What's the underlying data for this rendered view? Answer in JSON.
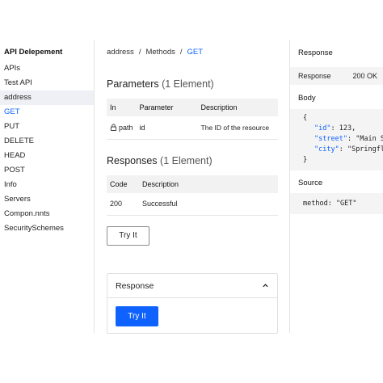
{
  "sidebar": {
    "title": "API Delepement",
    "items": [
      {
        "label": "APIs"
      },
      {
        "label": "Test API"
      },
      {
        "label": "address"
      },
      {
        "label": "GET"
      },
      {
        "label": "PUT"
      },
      {
        "label": "DELETE"
      },
      {
        "label": "HEAD"
      },
      {
        "label": "POST"
      },
      {
        "label": "Info"
      },
      {
        "label": "Servers"
      },
      {
        "label": "Compon.nnts"
      },
      {
        "label": "SecuritySchemes"
      }
    ]
  },
  "breadcrumb": {
    "items": [
      "address",
      "Methods",
      "GET"
    ],
    "separator": "/"
  },
  "parameters": {
    "title": "Parameters",
    "count": "(1 Element)",
    "headers": [
      "In",
      "Parameter",
      "Description"
    ],
    "rows": [
      {
        "in": "path",
        "parameter": "id",
        "description": "The ID of the resource"
      }
    ]
  },
  "responses": {
    "title": "Responses",
    "count": "(1 Element)",
    "headers": [
      "Code",
      "Description"
    ],
    "rows": [
      {
        "code": "200",
        "description": "Successful"
      }
    ]
  },
  "try_it_label": "Try It",
  "response_panel": {
    "title": "Response",
    "try_label": "Try It"
  },
  "right": {
    "response_title": "Response",
    "response_label": "Response",
    "response_status": "200 OK",
    "body_title": "Body",
    "body": {
      "open": "{",
      "lines": [
        {
          "key": "\"id\"",
          "value": ": 123,"
        },
        {
          "key": "\"street\"",
          "value": ": \"Main St\""
        },
        {
          "key": "\"city\"",
          "value": ": \"Springfle"
        }
      ],
      "close": "}"
    },
    "source_title": "Source",
    "source_code": "method: \"GET\""
  },
  "colors": {
    "accent": "#0f62fe",
    "panel_bg": "#f4f4f4"
  },
  "icons": {
    "lock": "lock-icon",
    "collapse": "chevron-up-icon"
  }
}
